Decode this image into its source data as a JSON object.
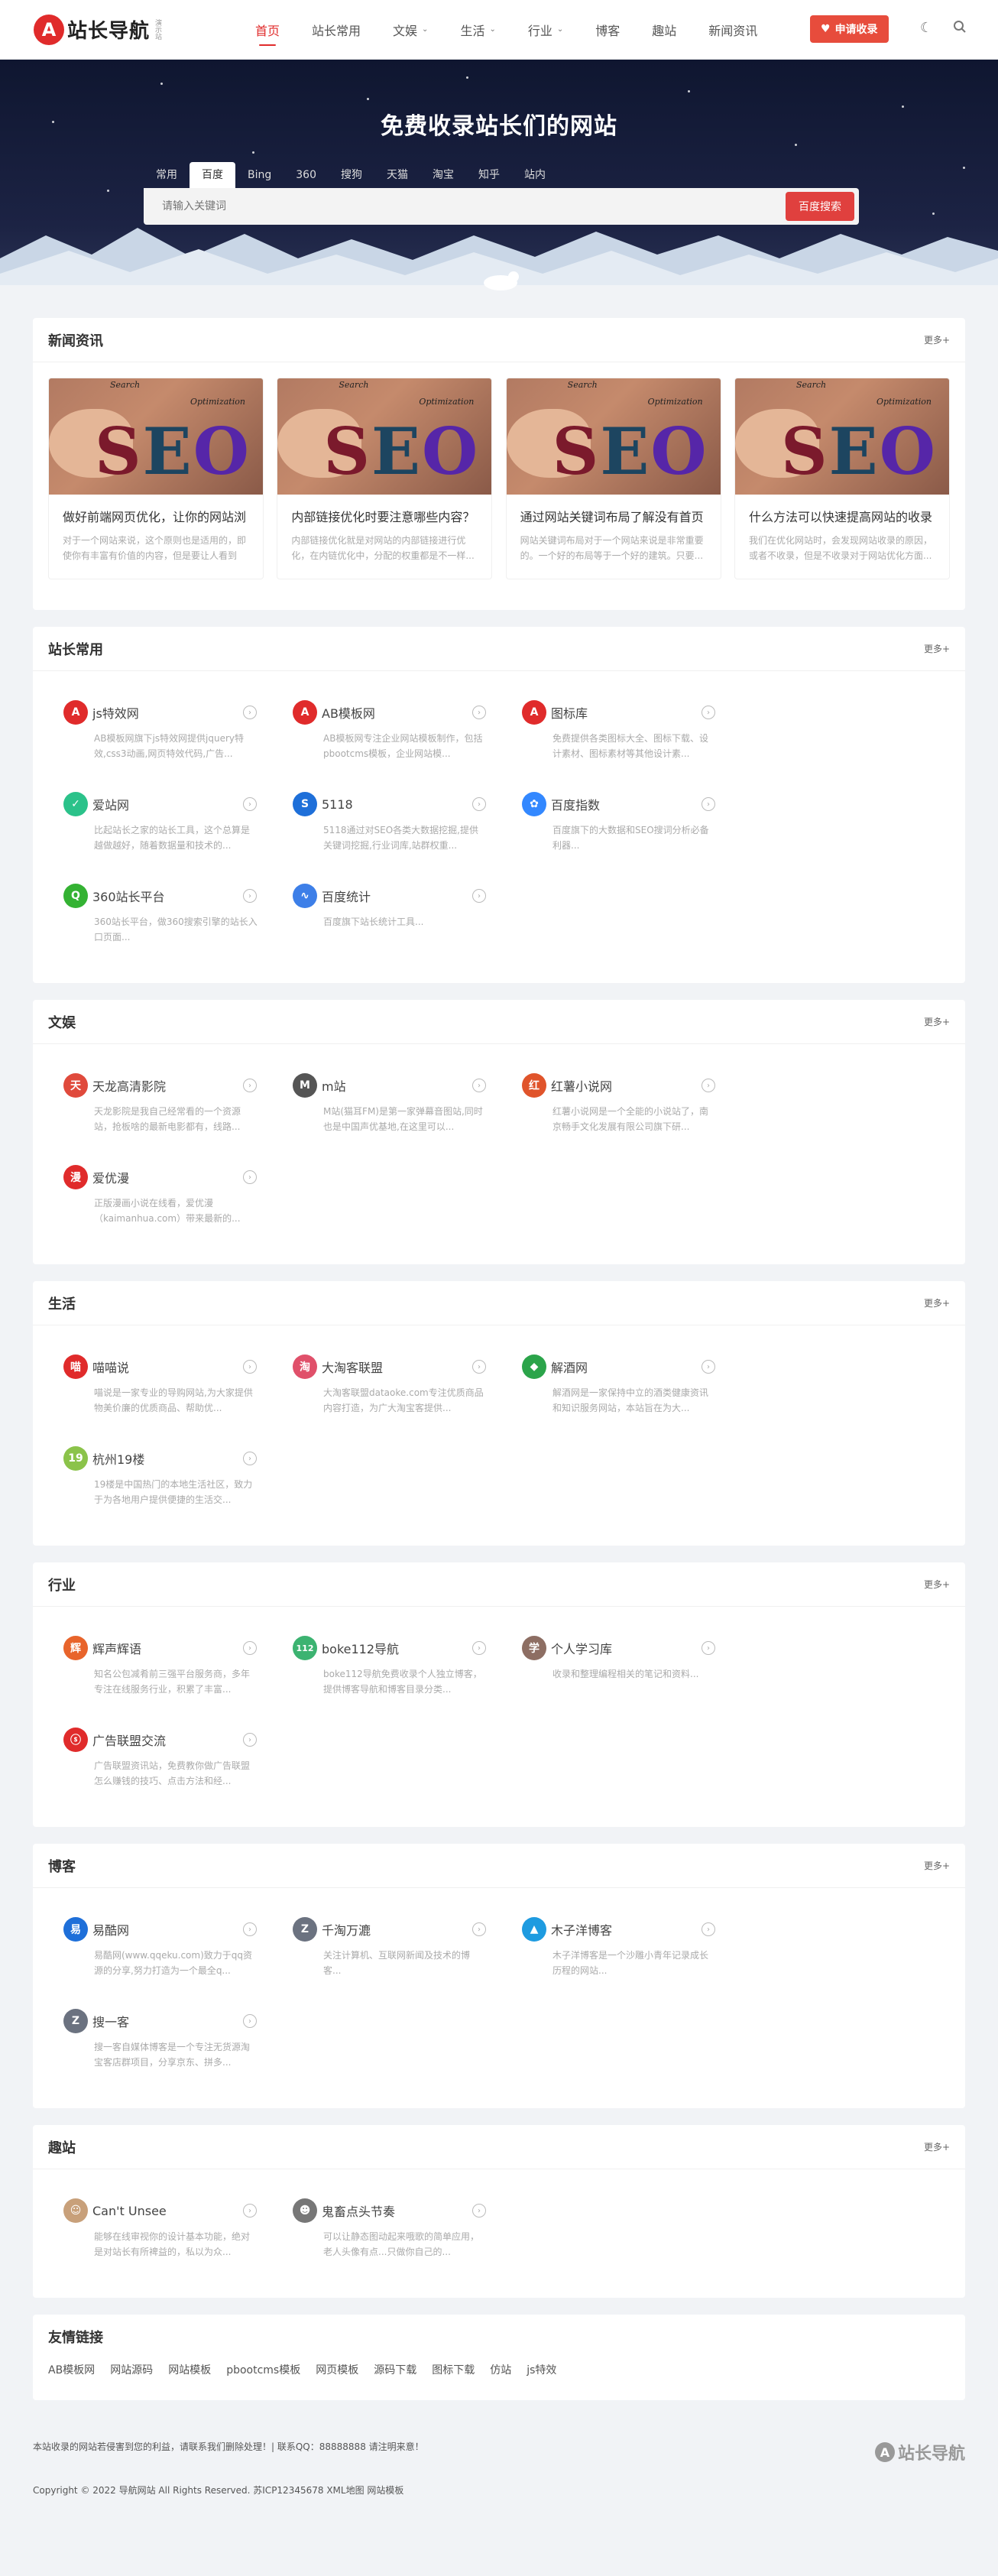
{
  "header": {
    "logo_mark": "A",
    "logo_text": "站长导航",
    "logo_sub": "演示站",
    "nav": [
      {
        "label": "首页",
        "active": true,
        "dropdown": false
      },
      {
        "label": "站长常用",
        "active": false,
        "dropdown": false
      },
      {
        "label": "文娱",
        "active": false,
        "dropdown": true
      },
      {
        "label": "生活",
        "active": false,
        "dropdown": true
      },
      {
        "label": "行业",
        "active": false,
        "dropdown": true
      },
      {
        "label": "博客",
        "active": false,
        "dropdown": false
      },
      {
        "label": "趣站",
        "active": false,
        "dropdown": false
      },
      {
        "label": "新闻资讯",
        "active": false,
        "dropdown": false
      }
    ],
    "apply_label": "申请收录",
    "theme_icon": "moon-icon",
    "search_icon": "search-icon"
  },
  "hero": {
    "title": "免费收录站长们的网站",
    "tabs": [
      "常用",
      "百度",
      "Bing",
      "360",
      "搜狗",
      "天猫",
      "淘宝",
      "知乎",
      "站内"
    ],
    "active_tab": "百度",
    "placeholder": "请输入关键词",
    "button": "百度搜索"
  },
  "news": {
    "title": "新闻资讯",
    "more": "更多+",
    "image_words": {
      "top": "Search",
      "side": "Optimization",
      "word": "SEO"
    },
    "cards": [
      {
        "title": "做好前端网页优化，让你的网站浏",
        "desc": "对于一个网站来说，这个原则也是适用的，即使你有丰富有价值的内容，但是要让人看到才..."
      },
      {
        "title": "内部链接优化时要注意哪些内容？",
        "desc": "内部链接优化就是对网站的内部链接进行优化，在内链优化中，分配的权重都是不一样..."
      },
      {
        "title": "通过网站关键词布局了解没有首页",
        "desc": "网站关键词布局对于一个网站来说是非常重要的。一个好的布局等于一个好的建筑。只要..."
      },
      {
        "title": "什么方法可以快速提高网站的收录",
        "desc": "我们在优化网站时，会发现网站收录的原因，或者不收录，但是不收录对于网站优化方面..."
      }
    ]
  },
  "sections": [
    {
      "title": "站长常用",
      "more": "更多+",
      "sites": [
        {
          "name": "js特效网",
          "desc": "AB模板网旗下js特效网提供jquery特效,css3动画,网页特效代码,广告...",
          "icon": "A",
          "color": "#e02b2b"
        },
        {
          "name": "AB模板网",
          "desc": "AB模板网专注企业网站模板制作，包括pbootcms模板，企业网站模...",
          "icon": "A",
          "color": "#e02b2b"
        },
        {
          "name": "图标库",
          "desc": "免费提供各类图标大全、图标下载、设计素材、图标素材等其他设计素...",
          "icon": "A",
          "color": "#e02b2b"
        },
        {
          "name": "爱站网",
          "desc": "比起站长之家的站长工具，这个总算是越做越好，随着数据量和技术的...",
          "icon": "✓",
          "color": "#2bc28a"
        },
        {
          "name": "5118",
          "desc": "5118通过对SEO各类大数据挖掘,提供关键词挖掘,行业词库,站群权重...",
          "icon": "S",
          "color": "#1e6fd9"
        },
        {
          "name": "百度指数",
          "desc": "百度旗下的大数据和SEO搜词分析必备利器...",
          "icon": "✿",
          "color": "#3388ff"
        },
        {
          "name": "360站长平台",
          "desc": "360站长平台，做360搜索引擎的站长入口页面...",
          "icon": "Q",
          "color": "#34b233"
        },
        {
          "name": "百度统计",
          "desc": "百度旗下站长统计工具...",
          "icon": "∿",
          "color": "#3d7fe8"
        }
      ]
    },
    {
      "title": "文娱",
      "more": "更多+",
      "sites": [
        {
          "name": "天龙高清影院",
          "desc": "天龙影院是我自己经常看的一个资源站，抢板啥的最新电影都有，线路...",
          "icon": "天",
          "color": "#e04a3c"
        },
        {
          "name": "m站",
          "desc": "M站(猫耳FM)是第一家弹幕音图站,同时也是中国声优基地,在这里可以...",
          "icon": "M",
          "color": "#555555"
        },
        {
          "name": "红薯小说网",
          "desc": "红薯小说网是一个全能的小说站了，南京畅手文化发展有限公司旗下研...",
          "icon": "红",
          "color": "#e0542b"
        },
        {
          "name": "爱优漫",
          "desc": "正版漫画小说在线看，爱优漫（kaimanhua.com）带来最新的...",
          "icon": "漫",
          "color": "#e02b2b"
        }
      ]
    },
    {
      "title": "生活",
      "more": "更多+",
      "sites": [
        {
          "name": "喵喵说",
          "desc": "喵说是一家专业的导购网站,为大家提供物美价廉的优质商品、帮助优...",
          "icon": "喵",
          "color": "#e02b2b"
        },
        {
          "name": "大淘客联盟",
          "desc": "大淘客联盟dataoke.com专注优质商品内容打造，为广大淘宝客提供...",
          "icon": "淘",
          "color": "#e0506a"
        },
        {
          "name": "解酒网",
          "desc": "解酒网是一家保持中立的酒类健康资讯和知识服务网站，本站旨在为大...",
          "icon": "◆",
          "color": "#2ba44a"
        },
        {
          "name": "杭州19楼",
          "desc": "19楼是中国热门的本地生活社区，致力于为各地用户提供便捷的生活交...",
          "icon": "19",
          "color": "#8bc34a"
        }
      ]
    },
    {
      "title": "行业",
      "more": "更多+",
      "sites": [
        {
          "name": "辉声辉语",
          "desc": "知名公包减肴前三强平台服务商，多年专注在线服务行业，积累了丰富...",
          "icon": "辉",
          "color": "#e8642b"
        },
        {
          "name": "boke112导航",
          "desc": "boke112导航免费收录个人独立博客，提供博客导航和博客目录分类...",
          "icon": "112",
          "color": "#3cb371"
        },
        {
          "name": "个人学习库",
          "desc": "收录和整理编程相关的笔记和资料...",
          "icon": "学",
          "color": "#8d6e63"
        },
        {
          "name": "广告联盟交流",
          "desc": "广告联盟资讯站，免费教你做广告联盟怎么赚钱的技巧、点击方法和经...",
          "icon": "ⓢ",
          "color": "#e02b2b"
        }
      ]
    },
    {
      "title": "博客",
      "more": "更多+",
      "sites": [
        {
          "name": "易酷网",
          "desc": "易酷网(www.qqeku.com)致力于qq资源的分享,努力打造为一个最全q...",
          "icon": "易",
          "color": "#1e6fd9"
        },
        {
          "name": "千淘万漉",
          "desc": "关注计算机、互联网新闻及技术的博客...",
          "icon": "Z",
          "color": "#6b7280"
        },
        {
          "name": "木子洋博客",
          "desc": "木子洋博客是一个沙雕小青年记录成长历程的网站...",
          "icon": "▲",
          "color": "#1e9be0"
        },
        {
          "name": "搜一客",
          "desc": "搜一客自媒体博客是一个专注无货源淘宝客店群项目，分享京东、拼多...",
          "icon": "Z",
          "color": "#6b7280"
        }
      ]
    },
    {
      "title": "趣站",
      "more": "更多+",
      "sites": [
        {
          "name": "Can't Unsee",
          "desc": "能够在线审视你的设计基本功能，绝对是对站长有所裨益的，私以为众...",
          "icon": "☺",
          "color": "#c8a07a"
        },
        {
          "name": "鬼畜点头节奏",
          "desc": "可以让静态图动起来哦歌的简单应用，老人头像有点...只做你自己的...",
          "icon": "☻",
          "color": "#777777"
        }
      ]
    }
  ],
  "links": {
    "title": "友情链接",
    "items": [
      "AB模板网",
      "网站源码",
      "网站模板",
      "pbootcms模板",
      "网页模板",
      "源码下载",
      "图标下载",
      "仿站",
      "js特效"
    ]
  },
  "footer": {
    "notice": "本站收录的网站若侵害到您的利益，请联系我们删除处理！| 联系QQ：88888888 请注明来意！",
    "copyright": "Copyright © 2022 导航网站 All Rights Reserved. 苏ICP12345678 XML地图 网站模板",
    "logo_mark": "A",
    "logo_text": "站长导航"
  }
}
